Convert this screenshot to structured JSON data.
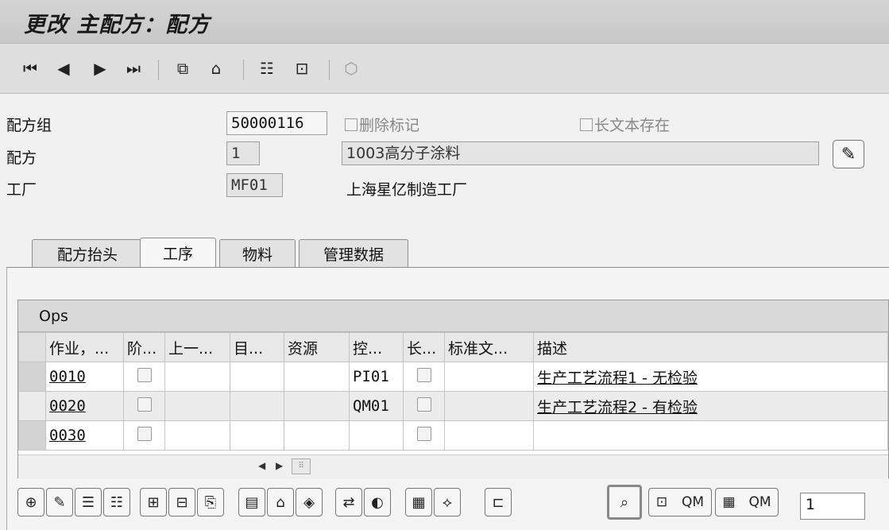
{
  "window": {
    "title": "更改 主配方：配方"
  },
  "toolbar": {
    "icons": [
      "first-page-icon",
      "previous-page-icon",
      "next-page-icon",
      "last-page-icon",
      "copy-icon",
      "hierarchy-icon",
      "structure-icon",
      "document-icon",
      "object-icon"
    ]
  },
  "header": {
    "group_label": "配方组",
    "group_value": "50000116",
    "delete_flag_label": "删除标记",
    "long_text_label": "长文本存在",
    "recipe_label": "配方",
    "recipe_value": "1",
    "recipe_desc": "1003高分子涂料",
    "plant_label": "工厂",
    "plant_value": "MF01",
    "plant_desc": "上海星亿制造工厂"
  },
  "tabs": [
    {
      "label": "配方抬头",
      "active": false
    },
    {
      "label": "工序",
      "active": true
    },
    {
      "label": "物料",
      "active": false
    },
    {
      "label": "管理数据",
      "active": false
    }
  ],
  "ops_table": {
    "caption": "Ops",
    "columns": [
      "作业，...",
      "阶...",
      "上一...",
      "目...",
      "资源",
      "控...",
      "长...",
      "标准文...",
      "描述"
    ],
    "rows": [
      {
        "op": "0010",
        "control": "PI01",
        "desc": "生产工艺流程1 - 无检验"
      },
      {
        "op": "0020",
        "control": "QM01",
        "desc": "生产工艺流程2 - 有检验"
      },
      {
        "op": "0030",
        "control": "",
        "desc": ""
      }
    ]
  },
  "bottom_bar": {
    "qm_label_1": "QM",
    "qm_label_2": "QM",
    "count_value": "1"
  }
}
